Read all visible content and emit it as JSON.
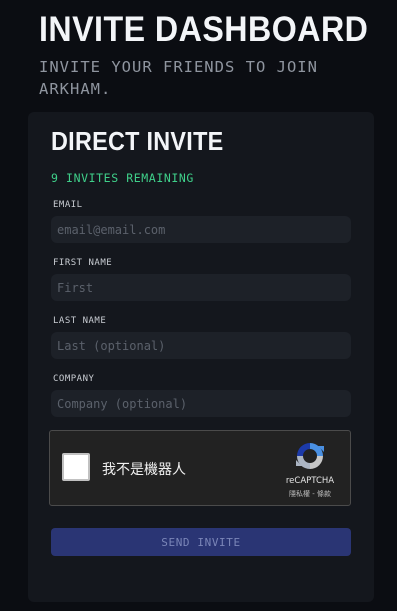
{
  "page": {
    "title": "INVITE DASHBOARD",
    "subtitle": "INVITE YOUR FRIENDS TO JOIN ARKHAM."
  },
  "card": {
    "title": "DIRECT INVITE",
    "invites_remaining": "9 INVITES REMAINING",
    "fields": [
      {
        "label": "EMAIL",
        "value": "",
        "placeholder": "email@email.com"
      },
      {
        "label": "FIRST NAME",
        "value": "",
        "placeholder": "First"
      },
      {
        "label": "LAST NAME",
        "value": "",
        "placeholder": "Last (optional)"
      },
      {
        "label": "COMPANY",
        "value": "",
        "placeholder": "Company (optional)"
      }
    ],
    "captcha": {
      "label": "我不是機器人",
      "brand": "reCAPTCHA",
      "links": "隱私權 - 條款",
      "icon": "recaptcha-icon",
      "checked": false
    },
    "send_button": "SEND INVITE"
  },
  "colors": {
    "background": "#0b0d12",
    "card": "#14171d",
    "accent_green": "#3fd08a",
    "button": "#2a3574"
  }
}
